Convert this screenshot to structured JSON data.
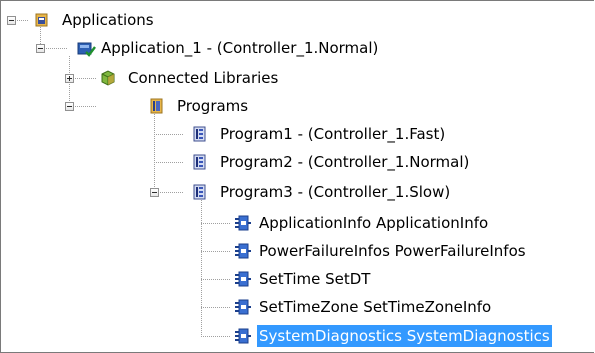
{
  "tree": {
    "applications": {
      "label": "Applications",
      "icon": "applications-folder-icon"
    },
    "application_1": {
      "label": "Application_1 - (Controller_1.Normal)",
      "icon": "application-check-icon"
    },
    "connected_libraries": {
      "label": "Connected Libraries",
      "icon": "library-cube-icon"
    },
    "programs": {
      "label": "Programs",
      "icon": "programs-folder-icon"
    },
    "program1": {
      "label": "Program1 - (Controller_1.Fast)",
      "icon": "program-icon"
    },
    "program2": {
      "label": "Program2 - (Controller_1.Normal)",
      "icon": "program-icon"
    },
    "program3": {
      "label": "Program3 - (Controller_1.Slow)",
      "icon": "program-icon"
    },
    "fb_items": [
      {
        "label": "ApplicationInfo  ApplicationInfo",
        "icon": "function-block-icon"
      },
      {
        "label": "PowerFailureInfos  PowerFailureInfos",
        "icon": "function-block-icon"
      },
      {
        "label": "SetTime  SetDT",
        "icon": "function-block-icon"
      },
      {
        "label": "SetTimeZone  SetTimeZoneInfo",
        "icon": "function-block-icon"
      },
      {
        "label": "SystemDiagnostics  SystemDiagnostics",
        "icon": "function-block-icon",
        "selected": true
      }
    ]
  },
  "colors": {
    "selection": "#3399ff",
    "tree_line": "#a0a0a0",
    "border": "#7a7a7a"
  }
}
